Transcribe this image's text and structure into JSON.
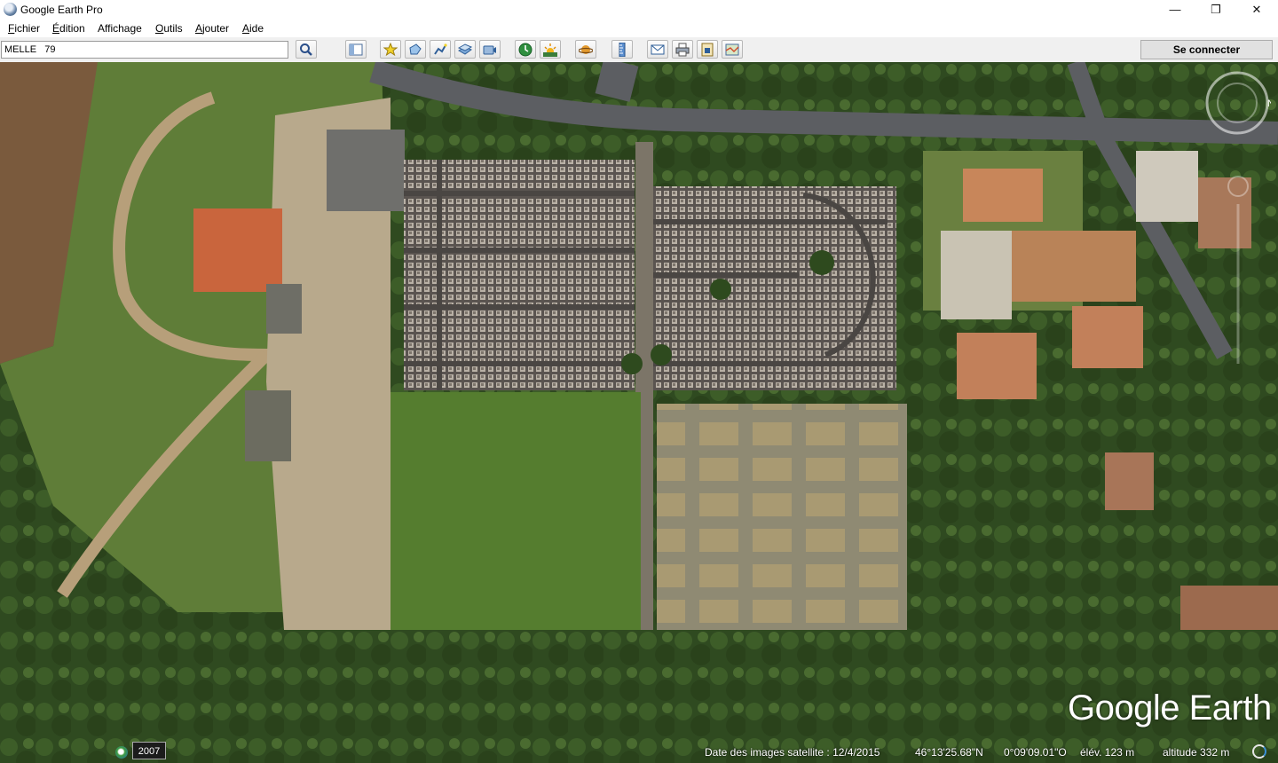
{
  "window": {
    "title": "Google Earth Pro",
    "controls": {
      "minimize": "—",
      "restore": "❐",
      "close": "✕"
    }
  },
  "menu": {
    "items": [
      {
        "underline": "F",
        "rest": "ichier"
      },
      {
        "underline": "É",
        "rest": "dition"
      },
      {
        "underline": "",
        "rest": "Affichage"
      },
      {
        "underline": "O",
        "rest": "utils"
      },
      {
        "underline": "A",
        "rest": "jouter"
      },
      {
        "underline": "A",
        "rest": "ide"
      }
    ]
  },
  "toolbar": {
    "search_value": "MELLE   79",
    "signin_label": "Se connecter",
    "icons": [
      "search-icon",
      "sidebar-toggle-icon",
      "placemark-icon",
      "polygon-icon",
      "path-icon",
      "image-overlay-icon",
      "record-tour-icon",
      "historical-imagery-icon",
      "sunlight-icon",
      "planets-icon",
      "ruler-icon",
      "email-icon",
      "print-icon",
      "save-image-icon",
      "view-in-maps-icon"
    ]
  },
  "map": {
    "watermark": "Google Earth",
    "compass_north": "N"
  },
  "status": {
    "year": "2007",
    "imagery_date": "Date des images satellite : 12/4/2015",
    "latitude": "46°13'25.68\"N",
    "longitude": "0°09'09.01\"O",
    "elevation": "élév.  123 m",
    "eye_altitude": "altitude    332 m"
  }
}
